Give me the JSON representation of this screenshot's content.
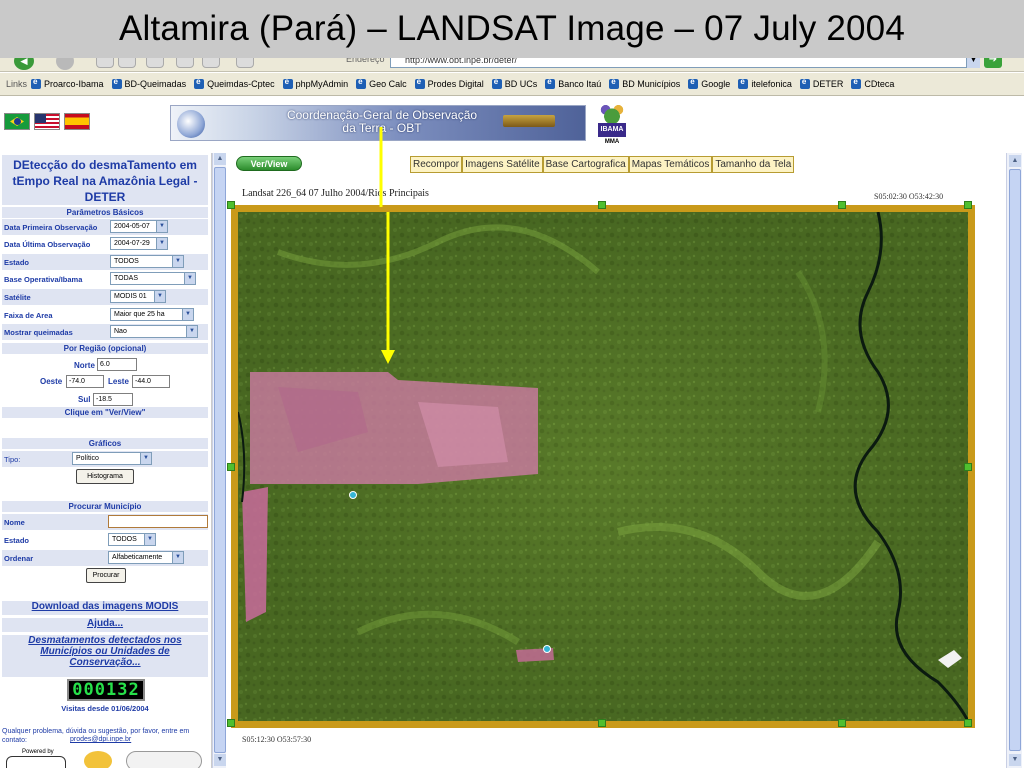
{
  "slide": {
    "title": "Altamira (Pará) – LANDSAT Image – 07 July 2004"
  },
  "browser": {
    "address_label": "Endereço",
    "address_url": "http://www.obt.inpe.br/deter/",
    "links_label": "Links",
    "links": [
      "Proarco-Ibama",
      "BD-Queimadas",
      "Queimdas-Cptec",
      "phpMyAdmin",
      "Geo Calc",
      "Prodes Digital",
      "BD UCs",
      "Banco Itaú",
      "BD Municípios",
      "Google",
      "itelefonica",
      "DETER",
      "CDteca"
    ]
  },
  "header": {
    "banner_line1": "Coordenação-Geral de Observação",
    "banner_line2": "da Terra - OBT",
    "ibama_label": "IBAMA",
    "mma_label": "MMA"
  },
  "sidebar": {
    "title": "DEtecção do desmaTamento em tEmpo Real na Amazônia Legal - DETER",
    "basic_params_heading": "Parâmetros Básicos",
    "fields": {
      "first_obs_label": "Data Primeira Observação",
      "first_obs_value": "2004-05-07",
      "last_obs_label": "Data Última Observação",
      "last_obs_value": "2004-07-29",
      "estado_label": "Estado",
      "estado_value": "TODOS",
      "base_label": "Base Operativa/Ibama",
      "base_value": "TODAS",
      "satelite_label": "Satélite",
      "satelite_value": "MODIS 01",
      "faixa_label": "Faixa de Area",
      "faixa_value": "Maior que 25 ha",
      "queimadas_label": "Mostrar queimadas",
      "queimadas_value": "Nao"
    },
    "region_heading": "Por Região (opcional)",
    "region": {
      "norte_label": "Norte",
      "norte_value": "6.0",
      "oeste_label": "Oeste",
      "oeste_value": "-74.0",
      "leste_label": "Leste",
      "leste_value": "-44.0",
      "sul_label": "Sul",
      "sul_value": "-18.5"
    },
    "click_hint": "Clique em \"Ver/View\"",
    "graficos_heading": "Gráficos",
    "tipo_label": "Tipo:",
    "tipo_value": "Político",
    "histograma_button": "Histograma",
    "municipio_heading": "Procurar Município",
    "nome_label": "Nome",
    "nome_value": "",
    "mun_estado_label": "Estado",
    "mun_estado_value": "TODOS",
    "ordenar_label": "Ordenar",
    "ordenar_value": "Alfabeticamente",
    "procurar_button": "Procurar",
    "download_link": "Download das imagens MODIS",
    "ajuda_link": "Ajuda...",
    "desmatamentos_link": "Desmatamentos detectados nos Municípios ou Unidades de Conservação...",
    "counter_value": "000132",
    "visitas_text": "Visitas desde 01/06/2004",
    "contact_text": "Qualquer problema, dúvida ou sugestão, por favor, entre em contato:",
    "contact_email": "prodes@dpi.inpe.br",
    "powered_by": "Powered by"
  },
  "main": {
    "verview_button": "Ver/View",
    "tabs": [
      "Recompor",
      "Imagens Satélite",
      "Base Cartografica",
      "Mapas Temáticos",
      "Tamanho da Tela"
    ],
    "image_caption": "Landsat 226_64 07 Julho 2004/Rios Principais",
    "coord_top_right": "S05:02:30 O53:42:30",
    "coord_bottom_left": "S05:12:30 O53:57:30"
  },
  "colors": {
    "title_bar": "#c9c9c9",
    "panel_blue": "#1e3ba6",
    "panel_bg": "#dfe4f2",
    "frame_gold": "#c99a1a",
    "forest_green": "#4a6b22",
    "deforest_pink": "#c97aa0",
    "arrow_yellow": "#ffff00",
    "counter_green": "#27e04a"
  }
}
